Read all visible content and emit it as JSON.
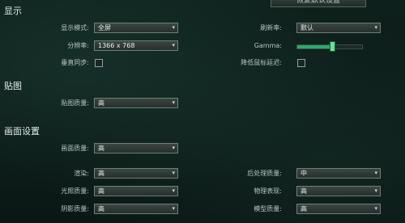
{
  "reset_button": "恢复默认设置",
  "sections": {
    "display": "显示",
    "texture": "贴图",
    "graphics": "画面设置"
  },
  "display": {
    "mode_label": "显示模式:",
    "mode_value": "全屏",
    "refresh_label": "刷新率:",
    "refresh_value": "默认",
    "resolution_label": "分辨率:",
    "resolution_value": "1366 x 768",
    "gamma_label": "Gamma:",
    "gamma_level": 0.55,
    "vsync_label": "垂直同步:",
    "mouse_latency_label": "降低鼠标延迟:"
  },
  "texture": {
    "quality_label": "贴图质量:",
    "quality_value": "高"
  },
  "graphics": {
    "quality_label": "画面质量:",
    "quality_value": "高",
    "render_label": "渲染:",
    "render_value": "高",
    "postprocess_label": "后处理质量:",
    "postprocess_value": "中",
    "lighting_label": "光照质量:",
    "lighting_value": "高",
    "physics_label": "物理表现:",
    "physics_value": "高",
    "shadow_label": "阴影质量:",
    "shadow_value": "高",
    "model_label": "模型质量:",
    "model_value": "高"
  }
}
